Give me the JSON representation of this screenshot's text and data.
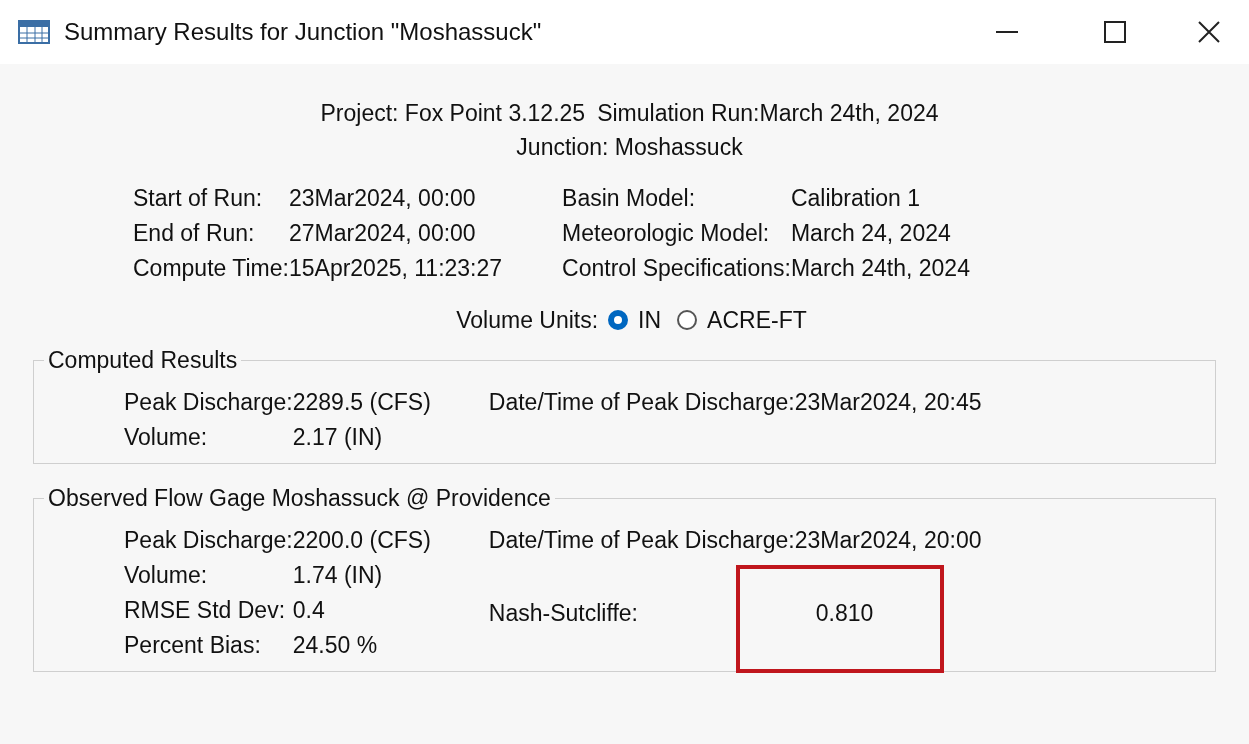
{
  "window": {
    "title": "Summary Results for Junction \"Moshassuck\""
  },
  "header": {
    "project": "Project: Fox Point 3.12.25",
    "simulation_run": "Simulation Run:March 24th, 2024",
    "junction": "Junction: Moshassuck"
  },
  "run_info_left": [
    {
      "label": "Start of Run:",
      "value": "23Mar2024, 00:00"
    },
    {
      "label": "End of Run:",
      "value": "27Mar2024, 00:00"
    },
    {
      "label": "Compute Time:",
      "value": "15Apr2025, 11:23:27"
    }
  ],
  "run_info_right": [
    {
      "label": "Basin Model:",
      "value": "Calibration 1"
    },
    {
      "label": "Meteorologic Model:",
      "value": "March 24, 2024"
    },
    {
      "label": "Control Specifications:",
      "value": "March 24th, 2024"
    }
  ],
  "volume_units": {
    "label": "Volume Units:",
    "options": [
      {
        "label": "IN",
        "selected": true
      },
      {
        "label": "ACRE-FT",
        "selected": false
      }
    ]
  },
  "groups": [
    {
      "title": "Computed Results",
      "left": [
        {
          "label": "Peak Discharge:",
          "value": "2289.5 (CFS)"
        },
        {
          "label": "Volume:",
          "value": "2.17 (IN)"
        }
      ],
      "right": [
        {
          "label": "Date/Time of Peak Discharge:",
          "value": "23Mar2024, 20:45"
        }
      ]
    },
    {
      "title": "Observed Flow Gage Moshassuck @ Providence",
      "left": [
        {
          "label": "Peak Discharge:",
          "value": "2200.0 (CFS)"
        },
        {
          "label": "Volume:",
          "value": "1.74 (IN)"
        },
        {
          "label": "RMSE Std Dev:",
          "value": "0.4"
        },
        {
          "label": "Percent Bias:",
          "value": "24.50 %"
        }
      ],
      "right": [
        {
          "label": "Date/Time of Peak Discharge:",
          "value": "23Mar2024, 20:00"
        }
      ],
      "score": {
        "label": "Nash-Sutcliffe:",
        "value": "0.810",
        "highlighted": true
      }
    }
  ]
}
